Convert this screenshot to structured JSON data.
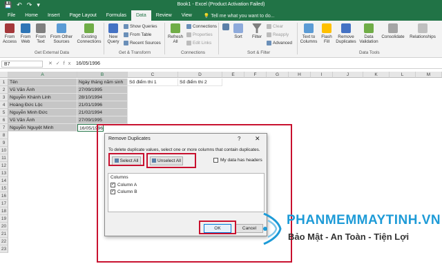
{
  "app": {
    "file_menu": "File",
    "title": "Book1 - Excel (Product Activation Failed)",
    "tabs": [
      "Home",
      "Insert",
      "Page Layout",
      "Formulas",
      "Data",
      "Review",
      "View"
    ],
    "active_tab": "Data",
    "tell_me": "Tell me what you want to do..."
  },
  "ribbon": {
    "get_external": {
      "from_access": "From Access",
      "from_web": "From Web",
      "from_text": "From Text",
      "from_other": "From Other Sources",
      "existing": "Existing Connections",
      "label": "Get External Data"
    },
    "get_transform": {
      "new_query": "New Query",
      "show_queries": "Show Queries",
      "from_table": "From Table",
      "recent_sources": "Recent Sources",
      "label": "Get & Transform"
    },
    "connections": {
      "refresh_all": "Refresh All",
      "connections": "Connections",
      "properties": "Properties",
      "edit_links": "Edit Links",
      "label": "Connections"
    },
    "sort_filter": {
      "sort": "Sort",
      "filter": "Filter",
      "clear": "Clear",
      "reapply": "Reapply",
      "advanced": "Advanced",
      "label": "Sort & Filter"
    },
    "data_tools": {
      "text_to_columns": "Text to Columns",
      "flash_fill": "Flash Fill",
      "remove_duplicates": "Remove Duplicates",
      "data_validation": "Data Validation",
      "consolidate": "Consolidate",
      "relationships": "Relationships",
      "label": "Data Tools"
    }
  },
  "formula_bar": {
    "name_box": "B7",
    "value": "16/05/1996"
  },
  "sheet": {
    "columns": [
      "A",
      "B",
      "C",
      "D",
      "E",
      "F",
      "G",
      "H",
      "I",
      "J",
      "K",
      "L",
      "M"
    ],
    "selected_columns": [
      "A",
      "B"
    ],
    "row_numbers": [
      "1",
      "2",
      "3",
      "4",
      "5",
      "6",
      "7",
      "8",
      "9",
      "10",
      "11",
      "12",
      "13",
      "14",
      "15",
      "16",
      "17",
      "18",
      "19",
      "20",
      "21",
      "22",
      "23"
    ],
    "header_row": [
      "Tên",
      "Ngày tháng năm sinh",
      "Số điểm thi 1",
      "Số điểm thi 2"
    ],
    "data_rows": [
      [
        "Vũ Văn Ánh",
        "27/09/1995"
      ],
      [
        "Nguyễn Khánh Linh",
        "28/10/1994"
      ],
      [
        "Hoàng Đức Lộc",
        "21/01/1996"
      ],
      [
        "Nguyễn Minh Đức",
        "21/02/1994"
      ],
      [
        "Vũ Văn Ánh",
        "27/09/1995"
      ],
      [
        "Nguyễn Nguyệt Minh",
        "16/05/1996"
      ]
    ]
  },
  "dialog": {
    "title": "Remove Duplicates",
    "help": "?",
    "close": "✕",
    "message": "To delete duplicate values, select one or more columns that contain duplicates.",
    "select_all": "Select All",
    "unselect_all": "Unselect All",
    "has_headers": "My data has headers",
    "has_headers_checked": false,
    "columns_label": "Columns",
    "columns": [
      {
        "label": "Column A",
        "checked": true
      },
      {
        "label": "Column B",
        "checked": true
      }
    ],
    "ok": "OK",
    "cancel": "Cancel"
  },
  "watermark": {
    "brand": "PHANMEMMAYTINH.VN",
    "slogan": "Bảo Mật - An Toàn - Tiện Lợi"
  },
  "colors": {
    "excel_green": "#217346",
    "highlight_red": "#c8102e",
    "brand_blue": "#1e9bd7"
  }
}
